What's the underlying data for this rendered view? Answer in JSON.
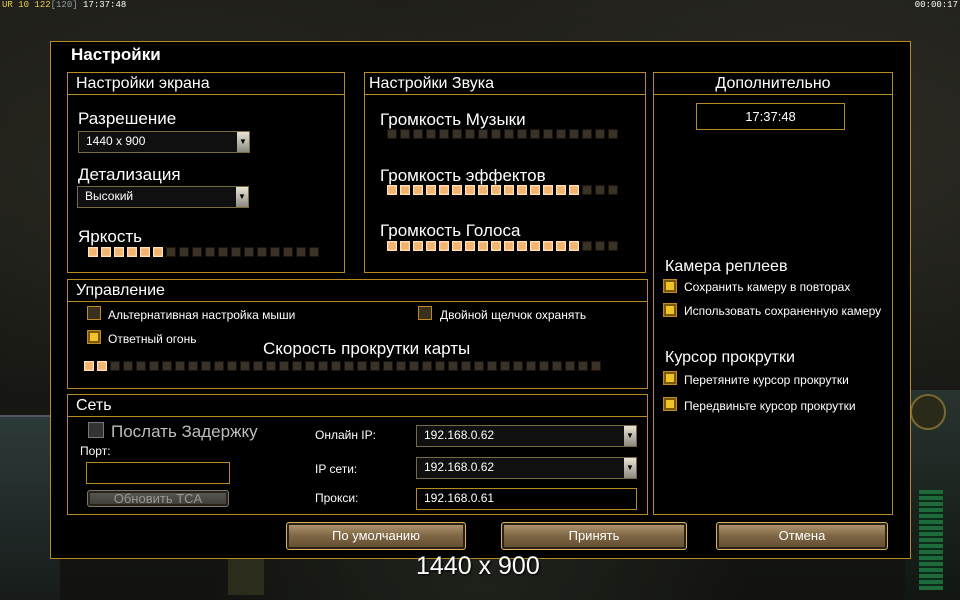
{
  "hud": {
    "left_prefix": "UR 10",
    "money": "122",
    "limit": "[120]",
    "clock": "17:37:48",
    "timer": "00:00:17"
  },
  "dialog": {
    "title": "Настройки",
    "screen": {
      "header": "Настройки экрана",
      "resolution_label": "Разрешение",
      "resolution_value": "1440 x 900",
      "detail_label": "Детализация",
      "detail_value": "Высокий",
      "brightness_label": "Яркость",
      "brightness_level": 6
    },
    "sound": {
      "header": "Настройки Звука",
      "music_label": "Громкость Музыки",
      "music_level": 0,
      "effects_label": "Громкость эффектов",
      "effects_level": 15,
      "voice_label": "Громкость Голоса",
      "voice_level": 15
    },
    "extra": {
      "header": "Дополнительно",
      "time": "17:37:48",
      "replay_cam_label": "Камера реплеев",
      "replay_save": "Сохранить камеру в повторах",
      "replay_use": "Использовать сохраненную камеру",
      "scroll_cursor_label": "Курсор прокрутки",
      "scroll_drag": "Перетяните курсор прокрутки",
      "scroll_move": "Передвиньте курсор прокрутки"
    },
    "control": {
      "header": "Управление",
      "alt_mouse": "Альтернативная настройка мыши",
      "double_click": "Двойной щелчок охранять",
      "return_fire": "Ответный огонь",
      "scroll_speed_label": "Скорость прокрутки карты",
      "scroll_speed_level": 2
    },
    "network": {
      "header": "Сеть",
      "send_delay": "Послать Задержку",
      "port_label": "Порт:",
      "port_value": "",
      "update_tca": "Обновить TCA",
      "online_ip_label": "Онлайн IP:",
      "online_ip": "192.168.0.62",
      "lan_ip_label": "IP сети:",
      "lan_ip": "192.168.0.62",
      "proxy_label": "Прокси:",
      "proxy": "192.168.0.61"
    },
    "buttons": {
      "default": "По умолчанию",
      "accept": "Принять",
      "cancel": "Отмена"
    }
  },
  "overlay_resolution": "1440 x 900",
  "colors": {
    "accent": "#b88a22",
    "slider_on": "#f2b36e",
    "check_on": "#f0c428"
  }
}
